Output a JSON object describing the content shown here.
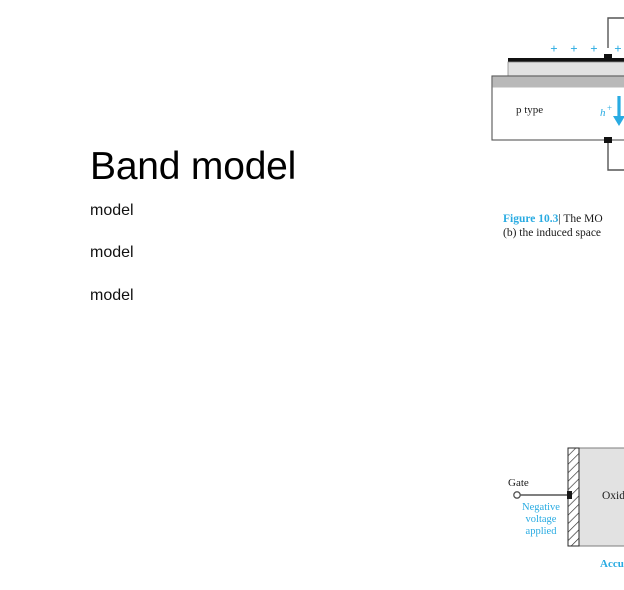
{
  "slide": {
    "title": "Band model",
    "body_lines": [
      "model",
      "model",
      "model"
    ]
  },
  "colors": {
    "accent_blue": "#29ABE2",
    "oxide_gray": "#e2e2e2",
    "semiconductor_band": "#b9b9b9",
    "metal_black": "#111111",
    "text_black": "#000000",
    "wire_gray": "#555555"
  },
  "figure_top": {
    "name": "mos-capacitor-diagram",
    "substrate_label": "p type",
    "charge_symbols": [
      "+",
      "+",
      "+",
      "+"
    ],
    "carrier_label": "h",
    "carrier_superscript": "+",
    "caption": {
      "figure_number": "Figure 10.3",
      "separator": "|",
      "line1_rest": "The MO",
      "line2": "(b) the induced space"
    }
  },
  "figure_bottom": {
    "name": "accumulation-mode-diagram",
    "gate_label": "Gate",
    "voltage_label_lines": [
      "Negative",
      "voltage",
      "applied"
    ],
    "oxide_label": "Oxide",
    "bottom_label": "Accu"
  }
}
